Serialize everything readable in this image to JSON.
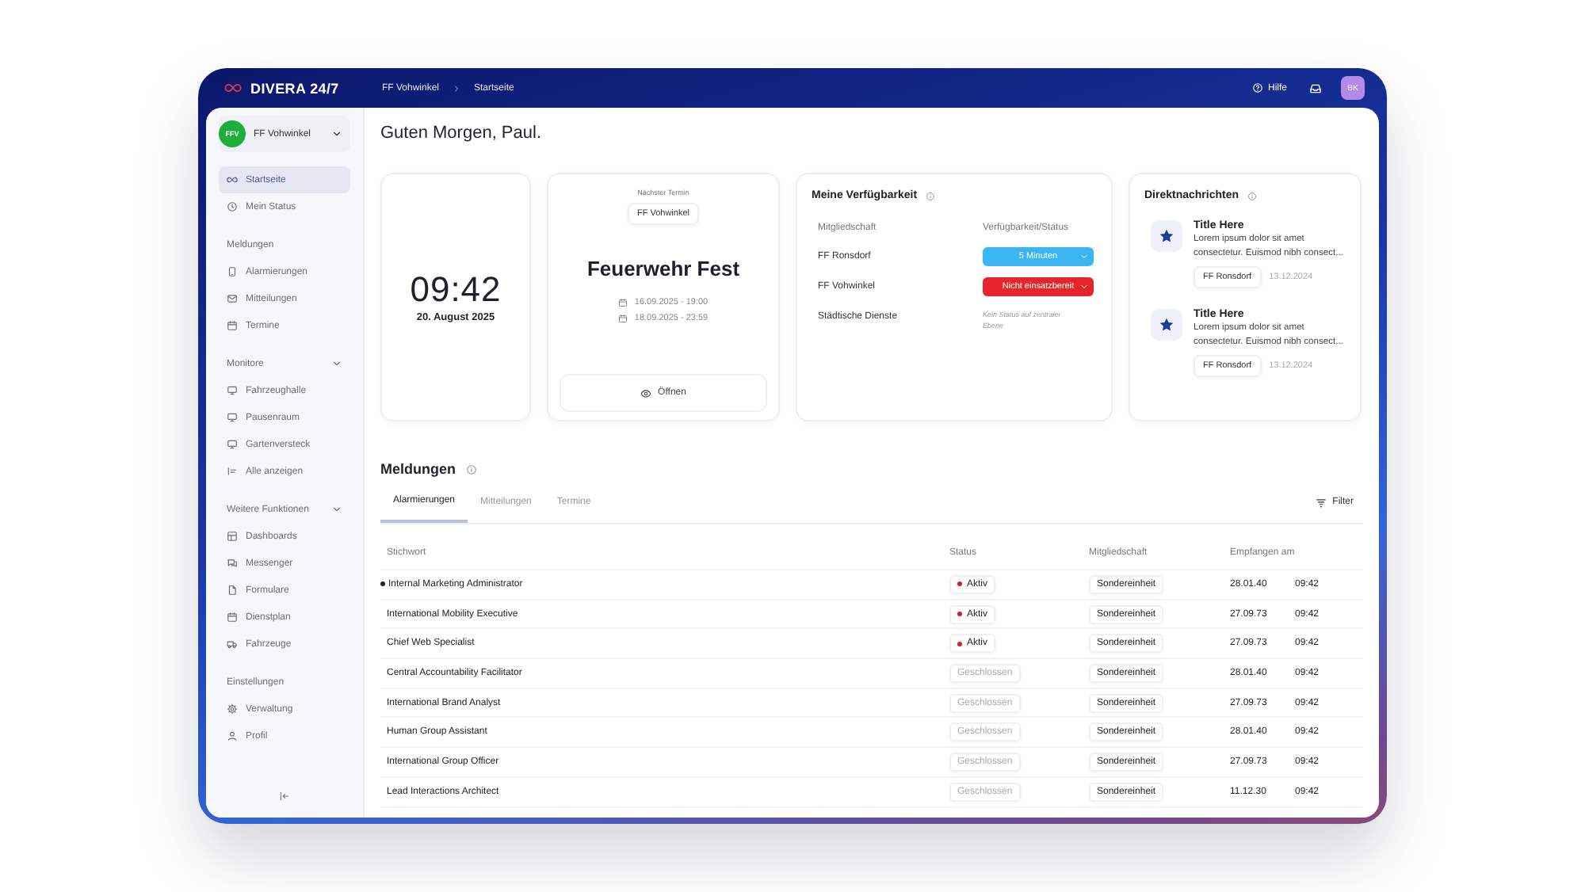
{
  "topbar": {
    "brand": "DIVERA 24/7",
    "breadcrumb": [
      "FF Vohwinkel",
      "Startseite"
    ],
    "help": "Hilfe",
    "avatar": "BK"
  },
  "sidebar": {
    "org": {
      "badge": "FFV",
      "name": "FF Vohwinkel"
    },
    "sections": [
      {
        "items": [
          {
            "label": "Startseite",
            "selected": true
          },
          {
            "label": "Mein Status",
            "selected": false
          }
        ]
      },
      {
        "title": "Meldungen",
        "collapsible": false,
        "items": [
          {
            "label": "Alarmierungen",
            "selected": false
          },
          {
            "label": "Mitteilungen",
            "selected": false
          },
          {
            "label": "Termine",
            "selected": false
          }
        ]
      },
      {
        "title": "Monitore",
        "collapsible": true,
        "items": [
          {
            "label": "Fahrzeughalle",
            "selected": false
          },
          {
            "label": "Pausenraum",
            "selected": false
          },
          {
            "label": "Gartenversteck",
            "selected": false
          },
          {
            "label": "Alle anzeigen",
            "selected": false
          }
        ]
      },
      {
        "title": "Weitere Funktionen",
        "collapsible": true,
        "items": [
          {
            "label": "Dashboards",
            "selected": false
          },
          {
            "label": "Messenger",
            "selected": false
          },
          {
            "label": "Formulare",
            "selected": false
          },
          {
            "label": "Dienstplan",
            "selected": false
          },
          {
            "label": "Fahrzeuge",
            "selected": false
          }
        ]
      },
      {
        "title": "Einstellungen",
        "collapsible": false,
        "items": [
          {
            "label": "Verwaltung",
            "selected": false
          },
          {
            "label": "Profil",
            "selected": false
          }
        ]
      }
    ]
  },
  "greeting": "Guten Morgen, Paul.",
  "clock": {
    "time": "09:42",
    "date": "20. August 2025"
  },
  "next_event": {
    "label": "Nächster Termin",
    "org": "FF Vohwinkel",
    "title": "Feuerwehr Fest",
    "start": "16.09.2025 - 19:00",
    "end": "18.09.2025 - 23:59",
    "button": "Öffnen"
  },
  "availability": {
    "title": "Meine Verfügbarkeit",
    "columns": [
      "Mitgliedschaft",
      "Verfügbarkeit/Status"
    ],
    "rows": [
      {
        "org": "FF Ronsdorf",
        "kind": "select",
        "status": "5 Minuten",
        "color": "#3bb6f2"
      },
      {
        "org": "FF Vohwinkel",
        "kind": "select",
        "status": "Nicht einsatzbereit",
        "color": "#e5252a"
      },
      {
        "org": "Städtische Dienste",
        "kind": "note",
        "status": "Kein Status auf zentraler Ebene"
      }
    ]
  },
  "messages": {
    "title": "Direktnachrichten",
    "items": [
      {
        "title": "Title Here",
        "text": "Lorem ipsum dolor sit amet consectetur. Euismod nibh consect...",
        "org": "FF Ronsdorf",
        "date": "13.12.2024"
      },
      {
        "title": "Title Here",
        "text": "Lorem ipsum dolor sit amet consectetur. Euismod nibh consect...",
        "org": "FF Ronsdorf",
        "date": "13.12.2024"
      }
    ]
  },
  "reports": {
    "title": "Meldungen",
    "tabs": [
      {
        "label": "Alarmierungen",
        "selected": true
      },
      {
        "label": "Mitteilungen",
        "selected": false
      },
      {
        "label": "Termine",
        "selected": false
      }
    ],
    "filter": "Filter",
    "columns": [
      "Stichwort",
      "Status",
      "Mitgliedschaft",
      "Empfangen am"
    ],
    "rows": [
      {
        "keyword": "Internal Marketing Administrator",
        "unread": true,
        "status": "Aktiv",
        "active": true,
        "membership": "Sondereinheit",
        "date": "28.01.40",
        "time": "09:42"
      },
      {
        "keyword": "International Mobility Executive",
        "unread": false,
        "status": "Aktiv",
        "active": true,
        "membership": "Sondereinheit",
        "date": "27.09.73",
        "time": "09:42"
      },
      {
        "keyword": "Chief Web Specialist",
        "unread": false,
        "status": "Aktiv",
        "active": true,
        "membership": "Sondereinheit",
        "date": "27.09.73",
        "time": "09:42"
      },
      {
        "keyword": "Central Accountability Facilitator",
        "unread": false,
        "status": "Geschlossen",
        "active": false,
        "membership": "Sondereinheit",
        "date": "28.01.40",
        "time": "09:42"
      },
      {
        "keyword": "International Brand Analyst",
        "unread": false,
        "status": "Geschlossen",
        "active": false,
        "membership": "Sondereinheit",
        "date": "27.09.73",
        "time": "09:42"
      },
      {
        "keyword": "Human Group Assistant",
        "unread": false,
        "status": "Geschlossen",
        "active": false,
        "membership": "Sondereinheit",
        "date": "28.01.40",
        "time": "09:42"
      },
      {
        "keyword": "International Group Officer",
        "unread": false,
        "status": "Geschlossen",
        "active": false,
        "membership": "Sondereinheit",
        "date": "27.09.73",
        "time": "09:42"
      },
      {
        "keyword": "Lead Interactions Architect",
        "unread": false,
        "status": "Geschlossen",
        "active": false,
        "membership": "Sondereinheit",
        "date": "11.12.30",
        "time": "09:42"
      }
    ]
  }
}
